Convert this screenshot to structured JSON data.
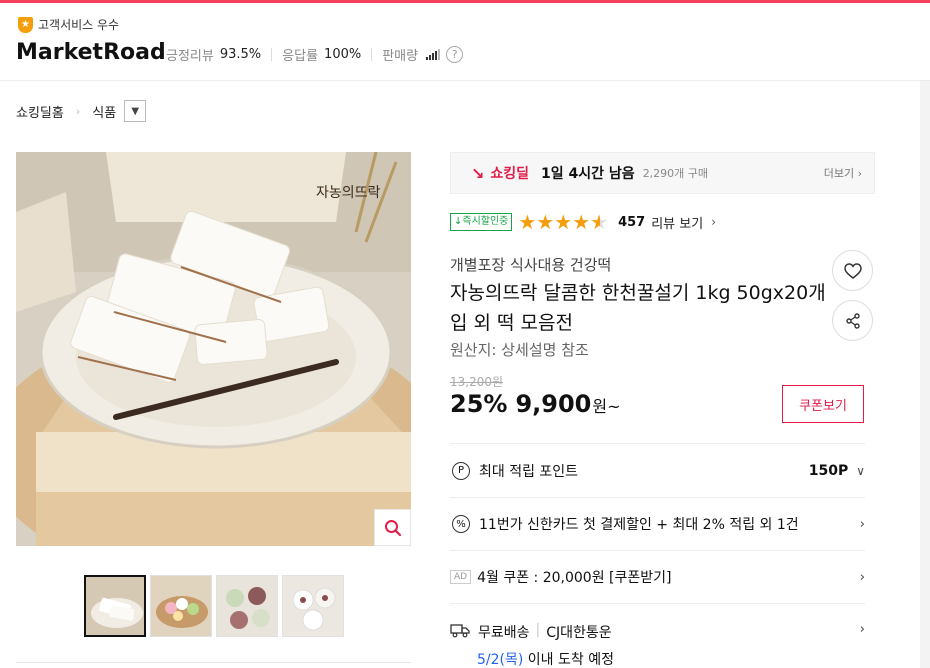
{
  "seller": {
    "badge_label": "고객서비스 우수",
    "store_name": "MarketRoad",
    "positive_review_label": "긍정리뷰",
    "positive_review_value": "93.5%",
    "response_label": "응답률",
    "response_value": "100%",
    "sales_label": "판매량",
    "help_glyph": "?"
  },
  "breadcrumb": {
    "home": "쇼킹딜홈",
    "category": "식품"
  },
  "deal": {
    "logo_label": "쇼킹딜",
    "time_left": "1일 4시간 남음",
    "purchase_count": "2,290개 구매",
    "more_label": "더보기 ›"
  },
  "rating": {
    "instant_badge": "↓즉시할인중",
    "stars": 4.5,
    "review_count": "457",
    "review_label": "리뷰 보기"
  },
  "product": {
    "subtitle": "개별포장 식사대용 건강떡",
    "title": "자농의뜨락 달콤한 한천꿀설기 1kg 50gx20개입 외 떡 모음전",
    "origin": "원산지: 상세설명 참조",
    "original_price": "13,200원",
    "discount": "25%",
    "price": "9,900",
    "price_suffix": "원~",
    "coupon_button": "쿠폰보기",
    "image_label": "자농의뜨락"
  },
  "info": {
    "points_icon": "P",
    "points_label": "최대 적립 포인트",
    "points_value": "150P",
    "card_icon": "%",
    "card_label": "11번가 신한카드 첫 결제할인 + 최대 2% 적립 외 1건",
    "ad_tag": "AD",
    "coupon_label": "4월 쿠폰 : 20,000원 [쿠폰받기]",
    "shipping_label": "무료배송",
    "shipping_carrier": "CJ대한통운",
    "arrival_date": "5/2(목)",
    "arrival_suffix": "이내 도착 예정"
  },
  "colors": {
    "accent": "#e11d48",
    "star": "#f59e0b",
    "instant": "#16a34a",
    "date_blue": "#2563eb"
  }
}
